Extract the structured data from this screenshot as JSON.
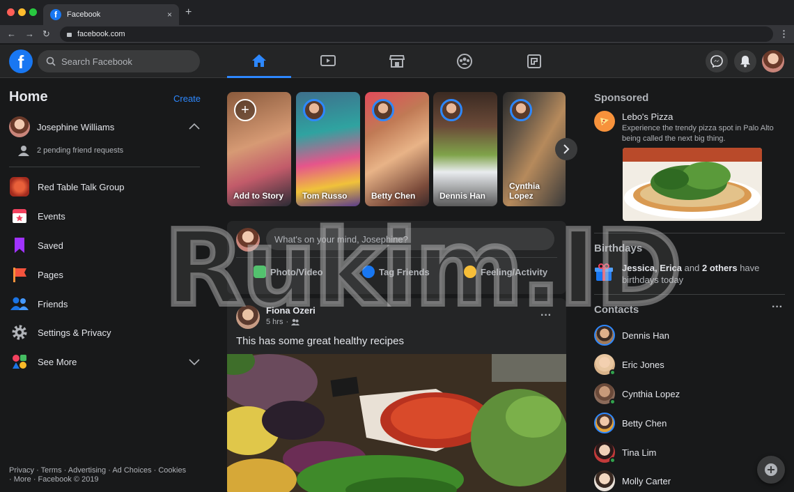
{
  "browser": {
    "tab_title": "Facebook",
    "tab_close": "×",
    "new_tab": "+",
    "url": "facebook.com"
  },
  "header": {
    "logo": "f",
    "search_placeholder": "Search Facebook",
    "nav_tabs": [
      "home-icon",
      "watch-icon",
      "marketplace-icon",
      "groups-icon",
      "gaming-icon"
    ],
    "right_icons": [
      "messenger-icon",
      "bell-icon",
      "avatar"
    ]
  },
  "left": {
    "title": "Home",
    "create": "Create",
    "user_name": "Josephine Williams",
    "pending": "2 pending friend requests",
    "items": [
      {
        "label": "Red Table Talk Group",
        "icon": "group-icon"
      },
      {
        "label": "Events",
        "icon": "calendar-icon"
      },
      {
        "label": "Saved",
        "icon": "bookmark-icon"
      },
      {
        "label": "Pages",
        "icon": "flag-icon"
      },
      {
        "label": "Friends",
        "icon": "friends-icon"
      },
      {
        "label": "Settings & Privacy",
        "icon": "gear-icon"
      },
      {
        "label": "See More",
        "icon": "shapes-icon"
      }
    ],
    "footer_line1": "Privacy · Terms · Advertising · Ad Choices · Cookies",
    "footer_line2": "· More · Facebook © 2019"
  },
  "stories": [
    {
      "name": "Add to Story"
    },
    {
      "name": "Tom Russo"
    },
    {
      "name": "Betty Chen"
    },
    {
      "name": "Dennis Han"
    },
    {
      "name": "Cynthia Lopez"
    }
  ],
  "composer": {
    "placeholder": "What's on your mind, Josephine?",
    "buttons": [
      "Photo/Video",
      "Tag Friends",
      "Feeling/Activity"
    ]
  },
  "post": {
    "author": "Fiona Ozeri",
    "time": "5 hrs",
    "text": "This has some great healthy recipes",
    "more": "···"
  },
  "right": {
    "sponsored_title": "Sponsored",
    "ad_name": "Lebo's Pizza",
    "ad_text": "Experience the trendy pizza spot in Palo Alto being called the next big thing.",
    "birthdays_title": "Birthdays",
    "birthday_names": "Jessica, Erica",
    "birthday_and": "and",
    "birthday_others": "2 others",
    "birthday_tail": "have birthdays today",
    "contacts_title": "Contacts",
    "contacts_more": "···",
    "contacts": [
      {
        "name": "Dennis Han",
        "online": false,
        "story": true
      },
      {
        "name": "Eric Jones",
        "online": true,
        "story": false
      },
      {
        "name": "Cynthia Lopez",
        "online": true,
        "story": false
      },
      {
        "name": "Betty Chen",
        "online": false,
        "story": true
      },
      {
        "name": "Tina Lim",
        "online": true,
        "story": false
      },
      {
        "name": "Molly Carter",
        "online": false,
        "story": false
      }
    ]
  },
  "watermark": "Rukim.ID",
  "colors": {
    "accent": "#2d88ff",
    "brand": "#1877f2",
    "bg": "#18191a",
    "card": "#242526",
    "online": "#31a24c"
  }
}
